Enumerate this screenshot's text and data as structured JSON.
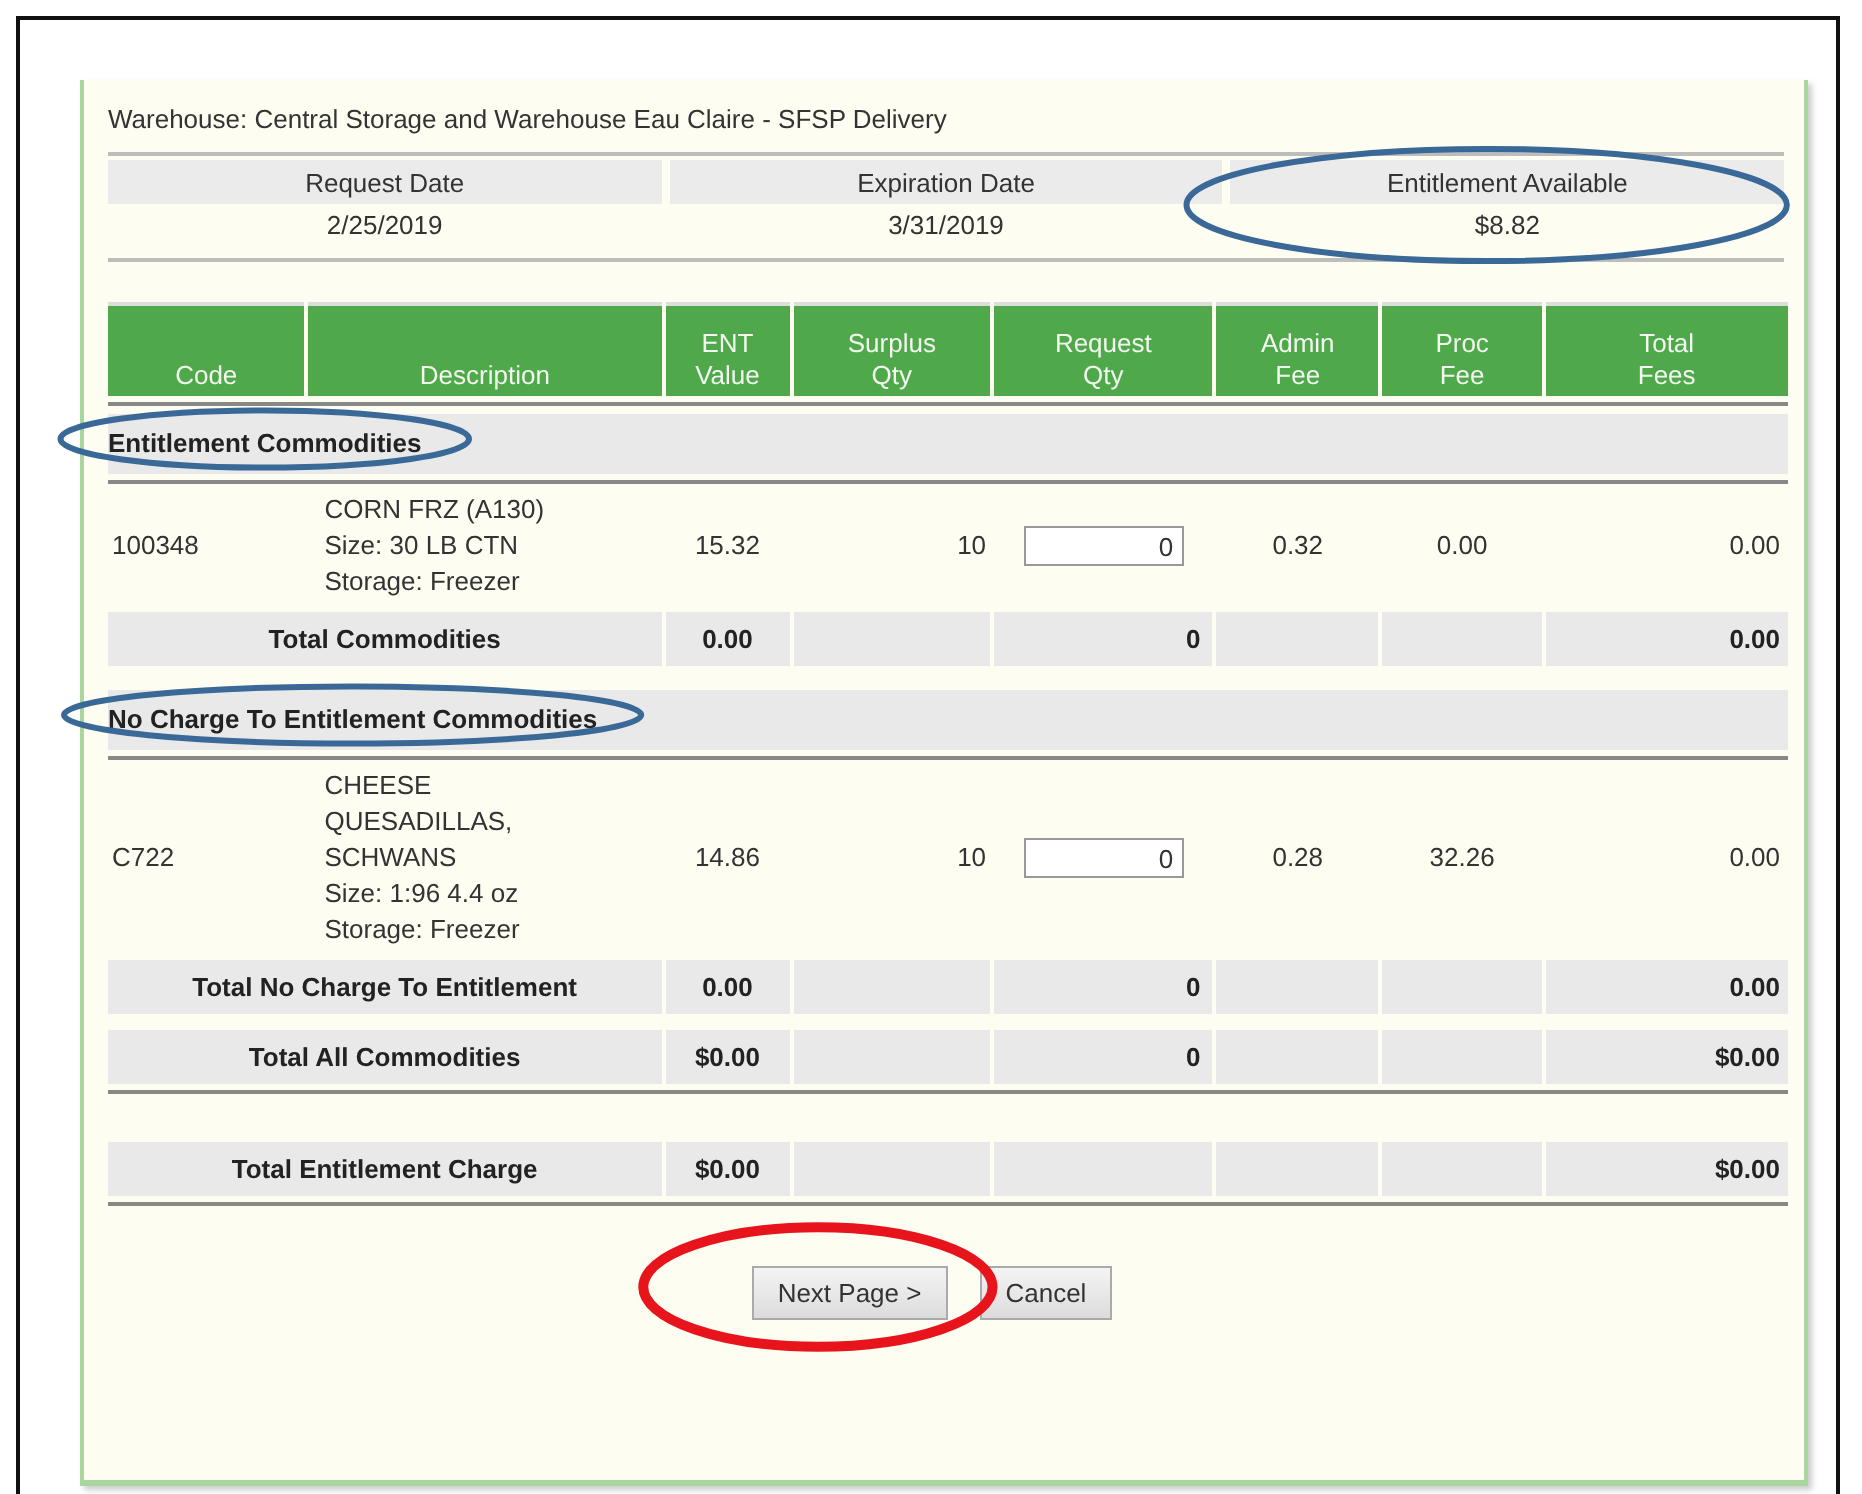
{
  "warehouse": "Warehouse: Central Storage and Warehouse Eau Claire - SFSP Delivery",
  "info": [
    {
      "label": "Request Date",
      "value": "2/25/2019"
    },
    {
      "label": "Expiration Date",
      "value": "3/31/2019"
    },
    {
      "label": "Entitlement Available",
      "value": "$8.82"
    }
  ],
  "table": {
    "columns": [
      [
        "Code"
      ],
      [
        "Description"
      ],
      [
        "ENT",
        "Value"
      ],
      [
        "Surplus",
        "Qty"
      ],
      [
        "Request",
        "Qty"
      ],
      [
        "Admin",
        "Fee"
      ],
      [
        "Proc",
        "Fee"
      ],
      [
        "Total",
        "Fees"
      ]
    ],
    "sections": [
      {
        "title": "Entitlement Commodities",
        "items": [
          {
            "code": "100348",
            "description": [
              "CORN FRZ (A130)",
              "Size:  30 LB CTN",
              "Storage:  Freezer"
            ],
            "ent_value": "15.32",
            "surplus_qty": "10",
            "request_qty": "0",
            "admin_fee": "0.32",
            "proc_fee": "0.00",
            "total_fees": "0.00"
          }
        ],
        "total": {
          "label": "Total Commodities",
          "ent_value": "0.00",
          "request_qty": "0",
          "total_fees": "0.00"
        }
      },
      {
        "title": "No Charge To Entitlement Commodities",
        "items": [
          {
            "code": "C722",
            "description": [
              "CHEESE",
              "QUESADILLAS,",
              "SCHWANS",
              "Size:  1:96 4.4 oz",
              "Storage:  Freezer"
            ],
            "ent_value": "14.86",
            "surplus_qty": "10",
            "request_qty": "0",
            "admin_fee": "0.28",
            "proc_fee": "32.26",
            "total_fees": "0.00"
          }
        ],
        "total": {
          "label": "Total No Charge To Entitlement",
          "ent_value": "0.00",
          "request_qty": "0",
          "total_fees": "0.00"
        }
      }
    ],
    "grand_totals": [
      {
        "label": "Total All Commodities",
        "ent_value": "$0.00",
        "request_qty": "0",
        "total_fees": "$0.00"
      },
      {
        "label": "Total Entitlement Charge",
        "ent_value": "$0.00",
        "total_fees": "$0.00"
      }
    ]
  },
  "buttons": [
    "Next Page >",
    "Cancel"
  ],
  "annotations": [
    {
      "color": "#3a6897"
    },
    {
      "color": "#3a6897"
    },
    {
      "color": "#3a6897"
    },
    {
      "color": "#e8141b"
    }
  ]
}
